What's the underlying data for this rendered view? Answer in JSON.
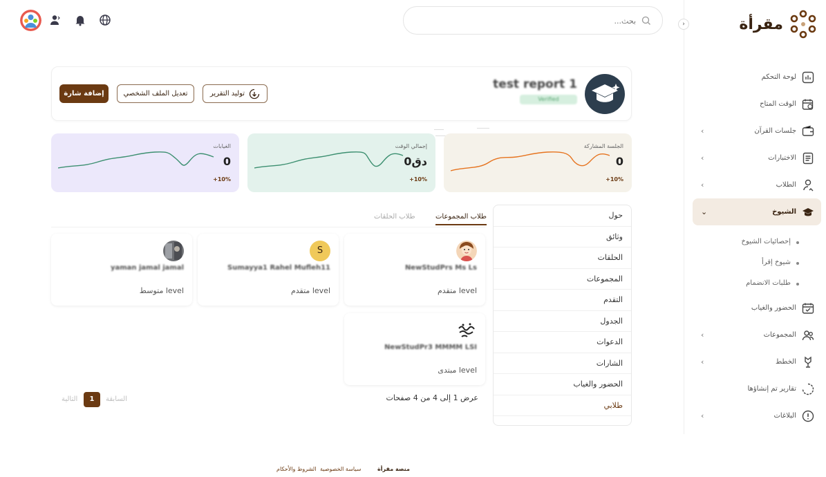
{
  "brand": {
    "name": "مقرأة"
  },
  "search": {
    "placeholder": "بحث..."
  },
  "sidebar": {
    "items": [
      {
        "label": "لوحة التحكم",
        "icon": "dashboard-icon",
        "has_children": false
      },
      {
        "label": "الوقت المتاح",
        "icon": "calendar-clock-icon",
        "has_children": false
      },
      {
        "label": "جلسات القرآن",
        "icon": "wallet-book-icon",
        "has_children": true
      },
      {
        "label": "الاختبارات",
        "icon": "document-icon",
        "has_children": true
      },
      {
        "label": "الطلاب",
        "icon": "student-icon",
        "has_children": true
      },
      {
        "label": "الشيوخ",
        "icon": "graduation-cap-icon",
        "has_children": true,
        "active": true
      }
    ],
    "sub_items": [
      {
        "label": "إحصائيات الشيوخ"
      },
      {
        "label": "شيوخ إقرأ"
      },
      {
        "label": "طلبات الانضمام"
      }
    ],
    "items_after": [
      {
        "label": "الحضور والغياب",
        "icon": "calendar-check-icon",
        "has_children": false
      },
      {
        "label": "المجموعات",
        "icon": "group-icon",
        "has_children": true
      },
      {
        "label": "الخطط",
        "icon": "plan-icon",
        "has_children": true
      },
      {
        "label": "تقارير تم إنشاؤها",
        "icon": "report-circle-icon",
        "has_children": false
      },
      {
        "label": "البلاغات",
        "icon": "alert-circle-icon",
        "has_children": true
      }
    ]
  },
  "profile": {
    "name": "test report 1",
    "badge": "Verified",
    "buttons": {
      "generate_report": "توليد التقرير",
      "edit_profile": "تعديل الملف الشخصي",
      "add_badge": "إضافة شارة"
    }
  },
  "stats": [
    {
      "title": "الجلسة المشاركة",
      "value": "0",
      "change": "+10%",
      "bg": "#f5f2ea",
      "line": "#e6731e"
    },
    {
      "title": "إجمالي الوقت",
      "value": "0دق",
      "change": "+10%",
      "bg": "#e3f2ec",
      "line": "#3c8f70"
    },
    {
      "title": "الغيابات",
      "value": "0",
      "change": "+10%",
      "bg": "#ece8fb",
      "line": "#3c8f70"
    }
  ],
  "menu": {
    "items": [
      "حول",
      "وثائق",
      "الحلقات",
      "المجموعات",
      "التقدم",
      "الجدول",
      "الدعوات",
      "الشارات",
      "الحضور والغياب",
      "طلابي"
    ]
  },
  "tabs": {
    "group_students": "طلاب المجموعات",
    "circle_students": "طلاب الحلقات"
  },
  "students": [
    {
      "name": "NewStudPrs Ms Ls",
      "level": "متقدم level",
      "avatar": "cartoon-avatar"
    },
    {
      "name": "Sumayya1 Rahel Mufleh11",
      "level": "متقدم level",
      "avatar": "S"
    },
    {
      "name": "yaman jamal jamal",
      "level": "متوسط level",
      "avatar": "photo-avatar"
    },
    {
      "name": "NewStudPr3 MMMM LSI",
      "level": "مبتدى level",
      "avatar": "calligraphy-avatar"
    }
  ],
  "pagination": {
    "info": "عرض 1 إلى 4 من 4 صفحات",
    "current": "1",
    "previous": "السابقة",
    "next": "التالية"
  },
  "footer": {
    "platform": "منصة مقرأة",
    "privacy": "سياسة الخصوصية",
    "terms": "الشروط والأحكام"
  },
  "colors": {
    "brand": "#6b3a12",
    "brand_light": "#f3ebe2"
  }
}
